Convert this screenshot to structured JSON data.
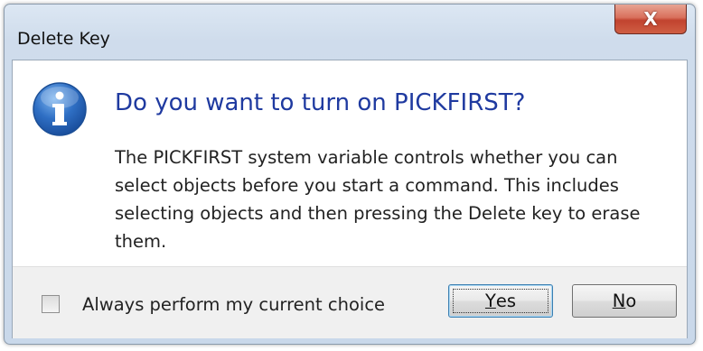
{
  "window": {
    "title": "Delete Key",
    "close_label": "X"
  },
  "message": {
    "icon": "info-icon",
    "heading": "Do you want to turn on PICKFIRST?",
    "body": "The PICKFIRST system variable controls whether you can select objects before you start a command. This includes selecting objects and then pressing the Delete key to erase them."
  },
  "footer": {
    "checkbox_label": "Always perform my current choice",
    "checkbox_checked": false,
    "yes_mnemonic": "Y",
    "yes_rest": "es",
    "no_mnemonic": "N",
    "no_rest": "o"
  },
  "colors": {
    "heading": "#1f3aa0",
    "close_button": "#c1432f",
    "info_icon": "#2f6fc4"
  }
}
